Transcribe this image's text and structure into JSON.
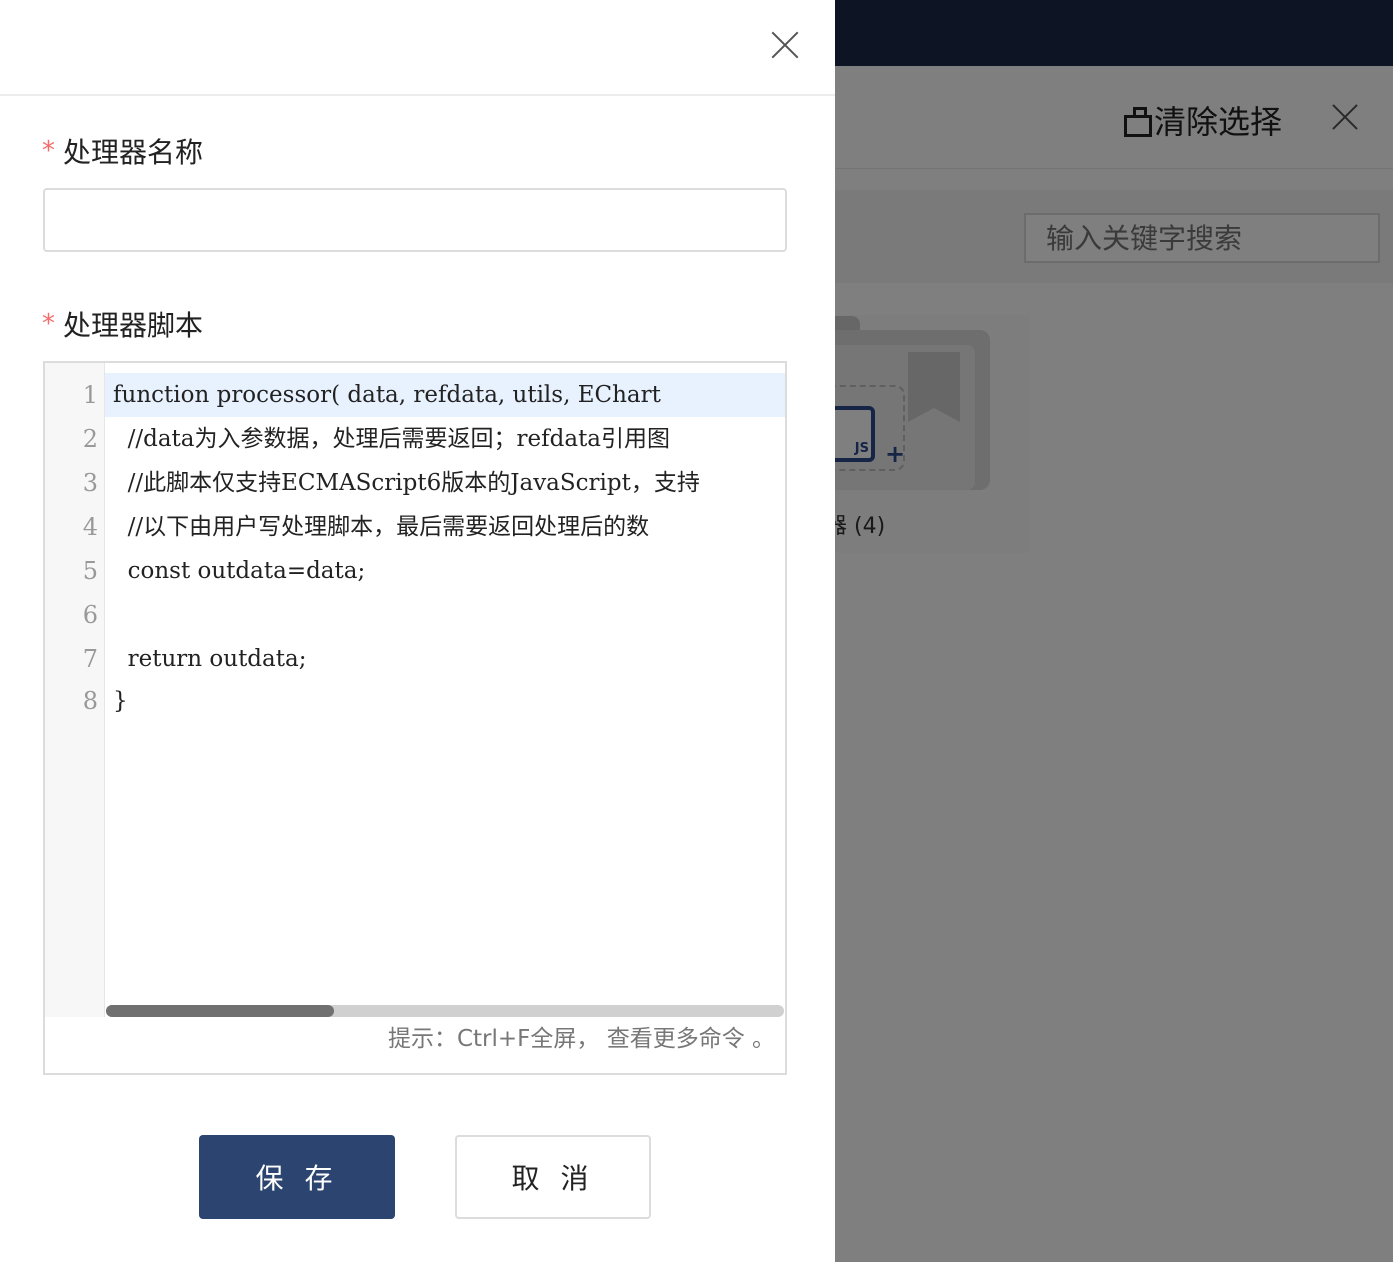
{
  "background": {
    "clear_selection": "清除选择",
    "search": {
      "placeholder": "输入关键字搜索"
    },
    "card": {
      "label": "器 (4)",
      "icon_text": "JS",
      "plus": "+"
    }
  },
  "drawer": {
    "name_field": {
      "label": "处理器名称",
      "required_mark": "*",
      "value": ""
    },
    "script_field": {
      "label": "处理器脚本",
      "required_mark": "*"
    },
    "editor": {
      "line_numbers": [
        "1",
        "2",
        "3",
        "4",
        "5",
        "6",
        "7",
        "8"
      ],
      "lines": [
        "function processor( data, refdata, utils, EChart",
        "  //data为入参数据，处理后需要返回；refdata引用图",
        "  //此脚本仅支持ECMAScript6版本的JavaScript，支持",
        "  //以下由用户写处理脚本，最后需要返回处理后的数",
        "  const outdata=data;",
        "",
        "  return outdata;",
        "}"
      ],
      "hint": "提示：Ctrl+F全屏， 查看更多命令 。"
    },
    "buttons": {
      "save": "保 存",
      "cancel": "取 消"
    }
  },
  "colors": {
    "primary": "#2b4570",
    "required": "#f56c6c",
    "topbar": "#1b2a48"
  }
}
